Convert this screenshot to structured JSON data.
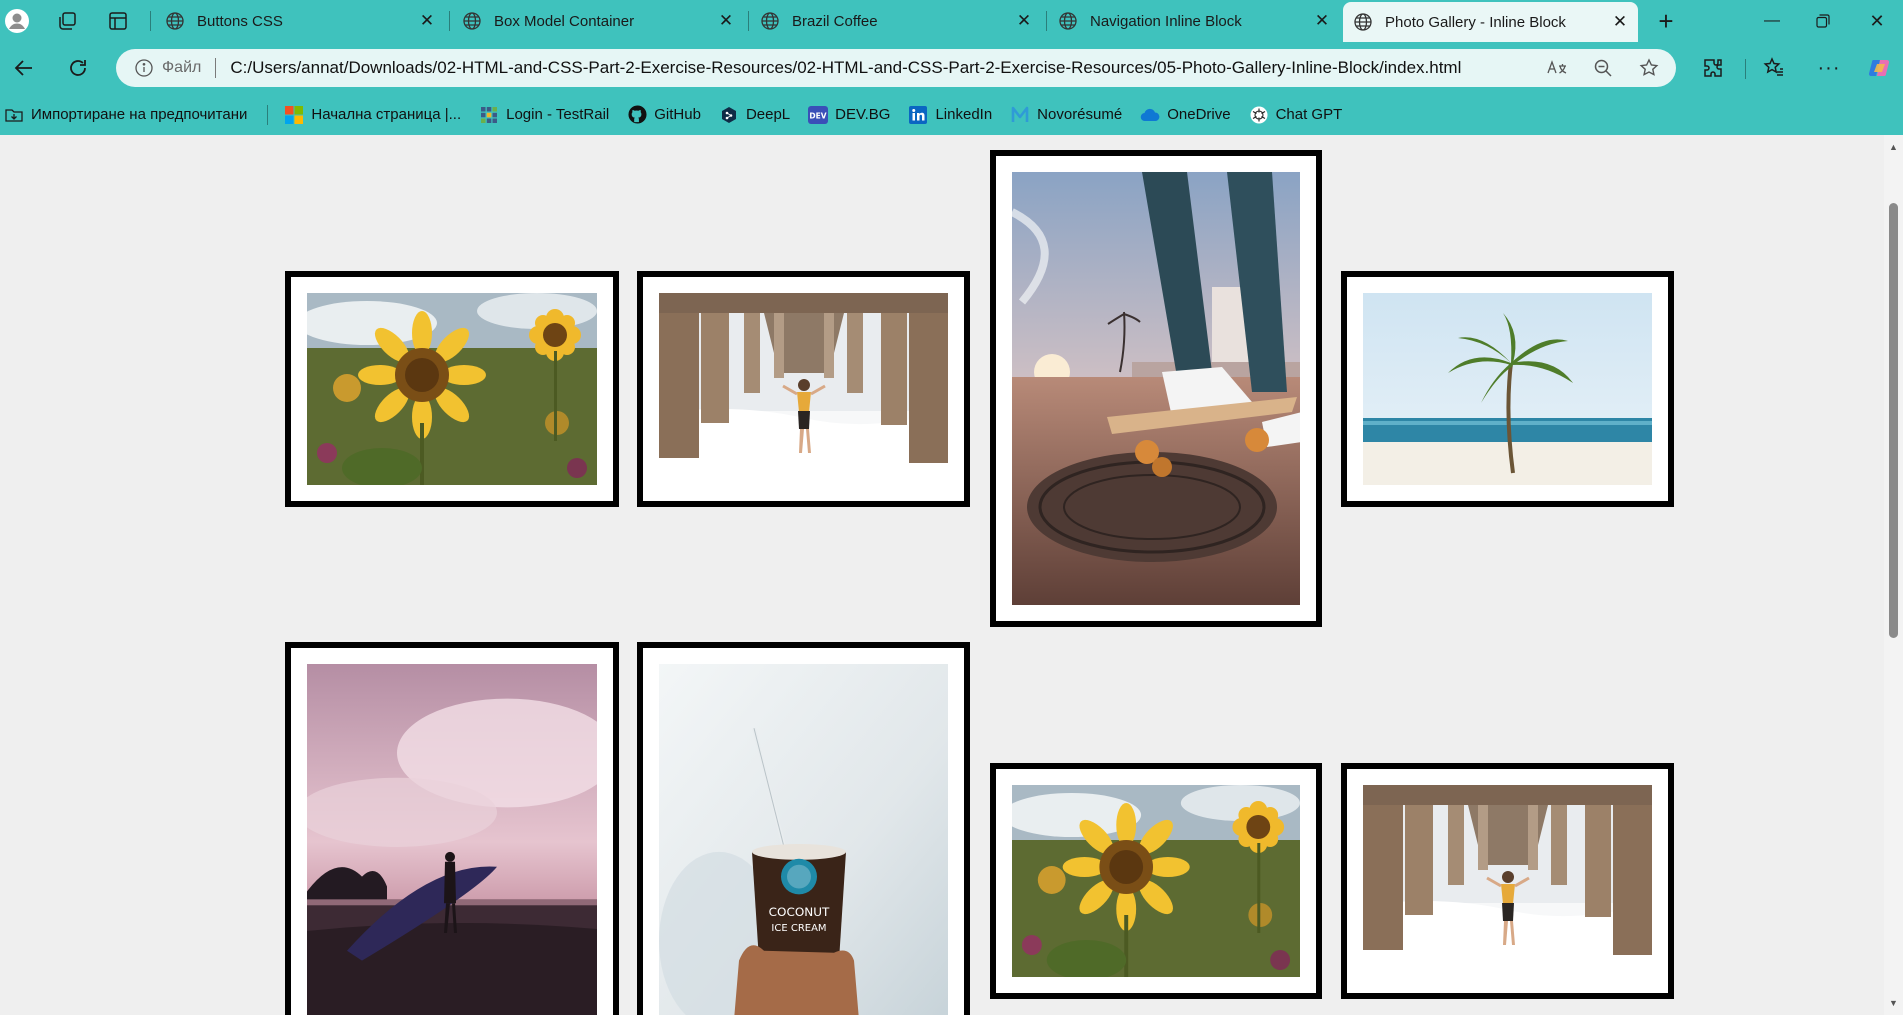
{
  "browser": {
    "tabs": [
      {
        "title": "Buttons CSS",
        "active": false
      },
      {
        "title": "Box Model Container",
        "active": false
      },
      {
        "title": "Brazil Coffee",
        "active": false
      },
      {
        "title": "Navigation Inline Block",
        "active": false
      },
      {
        "title": "Photo Gallery - Inline Block",
        "active": true
      }
    ],
    "address": {
      "scheme_label": "Файл",
      "url": "C:/Users/annat/Downloads/02-HTML-and-CSS-Part-2-Exercise-Resources/02-HTML-and-CSS-Part-2-Exercise-Resources/05-Photo-Gallery-Inline-Block/index.html"
    },
    "favorites": [
      {
        "label": "Импортиране на предпочитани",
        "icon": "folder-import-icon"
      },
      {
        "label": "Начална страница |...",
        "icon": "microsoft-logo-icon"
      },
      {
        "label": "Login - TestRail",
        "icon": "testrail-icon"
      },
      {
        "label": "GitHub",
        "icon": "github-icon"
      },
      {
        "label": "DeepL",
        "icon": "deepl-icon"
      },
      {
        "label": "DEV.BG",
        "icon": "devbg-icon"
      },
      {
        "label": "LinkedIn",
        "icon": "linkedin-icon"
      },
      {
        "label": "Novorésumé",
        "icon": "novoresume-icon"
      },
      {
        "label": "OneDrive",
        "icon": "onedrive-icon"
      },
      {
        "label": "Chat GPT",
        "icon": "chatgpt-icon"
      }
    ]
  },
  "gallery": {
    "photos": [
      {
        "subject": "sunflower",
        "orientation": "landscape"
      },
      {
        "subject": "pier-woman",
        "orientation": "landscape"
      },
      {
        "subject": "skateboard",
        "orientation": "portrait"
      },
      {
        "subject": "palm-beach",
        "orientation": "landscape"
      },
      {
        "subject": "surfer-sunset",
        "orientation": "portrait"
      },
      {
        "subject": "coconut-ice-cream",
        "orientation": "portrait"
      },
      {
        "subject": "sunflower",
        "orientation": "landscape"
      },
      {
        "subject": "pier-woman",
        "orientation": "landscape"
      }
    ],
    "frame_color": "#000000",
    "mat_color": "#ffffff",
    "page_background": "#efefef"
  },
  "colors": {
    "chrome": "#3fc2bd",
    "active_tab": "#eaf7f6"
  }
}
